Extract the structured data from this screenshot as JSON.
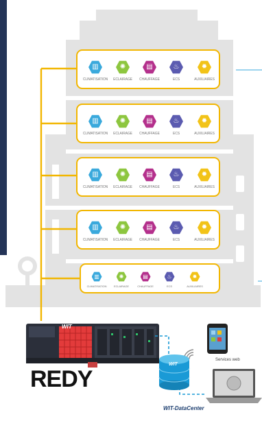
{
  "floors": [
    {
      "labels": [
        "CLIMATISATION",
        "ECLAIRAGE",
        "CHAUFFAGE",
        "ECS",
        "AUXILIAIRES"
      ]
    },
    {
      "labels": [
        "CLIMATISATION",
        "ECLAIRAGE",
        "CHAUFFAGE",
        "ECS",
        "AUXILIAIRES"
      ]
    },
    {
      "labels": [
        "CLIMATISATION",
        "ECLAIRAGE",
        "CHAUFFAGE",
        "ECS",
        "AUXILIAIRES"
      ]
    },
    {
      "labels": [
        "CLIMATISATION",
        "ECLAIRAGE",
        "CHAUFFAGE",
        "ECS",
        "AUXILIAIRES"
      ]
    },
    {
      "labels": [
        "CLIMATISATION",
        "ECLAIRAGE",
        "CHAUFFAGE",
        "ECS",
        "AUXILIAIRES"
      ]
    }
  ],
  "icons": [
    {
      "name": "climatisation-icon",
      "color": "#3aa9dc",
      "glyph": "▥"
    },
    {
      "name": "eclairage-icon",
      "color": "#8dc63f",
      "glyph": "✺"
    },
    {
      "name": "chauffage-icon",
      "color": "#b4308c",
      "glyph": "▤"
    },
    {
      "name": "ecs-icon",
      "color": "#5b5bb0",
      "glyph": "♨"
    },
    {
      "name": "auxiliaires-icon",
      "color": "#f2c318",
      "glyph": "✹"
    }
  ],
  "device": {
    "brand": "WIT"
  },
  "redy_logo": "REDY",
  "services_label": "Services web",
  "datacenter_label": "WIT-DataCenter",
  "datacenter_brand": "WIT",
  "colors": {
    "bus": "#f2b600",
    "network": "#1a9ad6",
    "navy": "#243457"
  }
}
